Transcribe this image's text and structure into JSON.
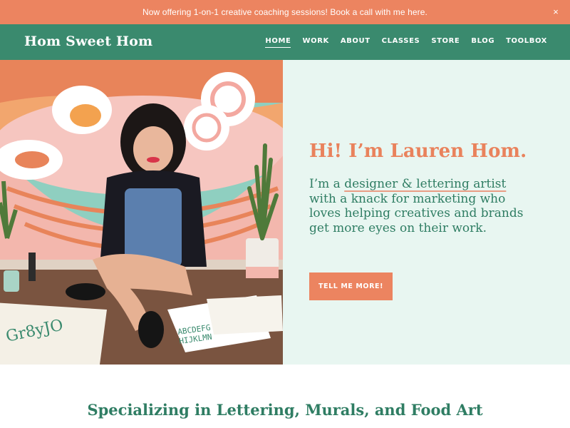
{
  "announcement": {
    "text": "Now offering 1-on-1 creative coaching sessions! Book a call with me here.",
    "close_glyph": "×"
  },
  "header": {
    "logo": "Hom Sweet Hom",
    "nav": [
      "HOME",
      "WORK",
      "ABOUT",
      "CLASSES",
      "STORE",
      "BLOG",
      "TOOLBOX"
    ],
    "active_item": "HOME"
  },
  "hero": {
    "title": "Hi! I’m Lauren Hom.",
    "body_prefix": "I’m a ",
    "body_highlight": "designer & lettering artist",
    "body_rest": " with a knack for marketing who loves helping creatives and brands get more eyes on their work.",
    "cta_label": "TELL ME MORE!"
  },
  "section": {
    "title": "Specializing in Lettering, Murals, and Food Art"
  },
  "colors": {
    "announcement_bg": "#ec8460",
    "header_bg": "#3a8a6e",
    "panel_bg": "#e8f6f1",
    "title_orange": "#e9825c",
    "body_green": "#2f7d63"
  }
}
